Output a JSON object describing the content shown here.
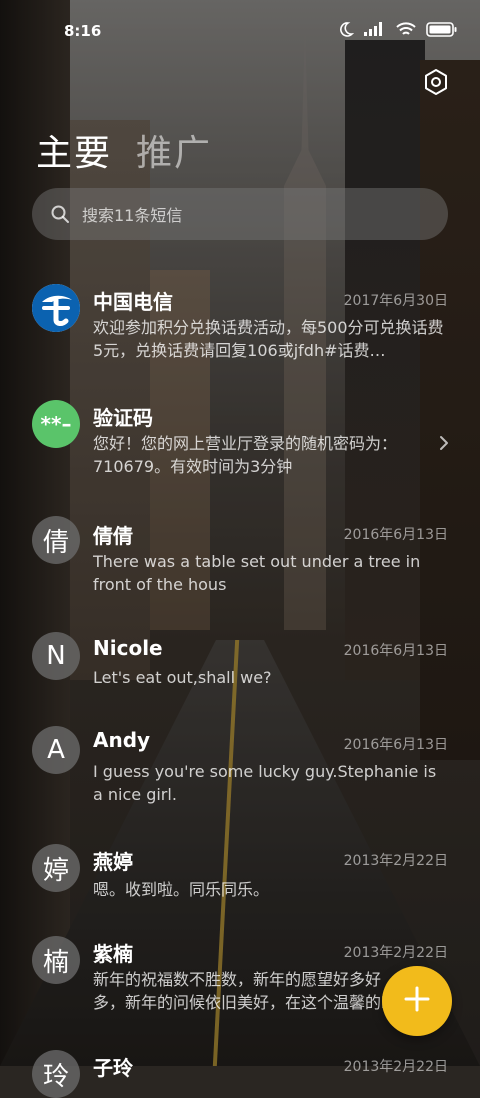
{
  "status_bar": {
    "time": "8:16"
  },
  "tabs": {
    "main": "主要",
    "promo": "推广"
  },
  "search": {
    "placeholder": "搜索11条短信"
  },
  "conversations": [
    {
      "name": "中国电信",
      "date": "2017年6月30日",
      "preview": "欢迎参加积分兑换话费活动，每500分可兑换话费5元，兑换话费请回复106或jfdh#话费…",
      "avatar": "telecom-logo"
    },
    {
      "name": "验证码",
      "date": "",
      "preview": "您好！您的网上营业厅登录的随机密码为：710679。有效时间为3分钟",
      "avatar": "**–"
    },
    {
      "name": "倩倩",
      "date": "2016年6月13日",
      "preview": "There was a table set out under a tree in front of the hous",
      "avatar": "倩"
    },
    {
      "name": "Nicole",
      "date": "2016年6月13日",
      "preview": "Let's eat out,shall we?",
      "avatar": "N"
    },
    {
      "name": "Andy",
      "date": "2016年6月13日",
      "preview": "I guess you're some lucky guy.Stephanie is a nice girl.",
      "avatar": "A"
    },
    {
      "name": "燕婷",
      "date": "2013年2月22日",
      "preview": "嗯。收到啦。同乐同乐。",
      "avatar": "婷"
    },
    {
      "name": "紫楠",
      "date": "2013年2月22日",
      "preview": "新年的祝福数不胜数，新年的愿望好多好多，新年的问候依旧美好，在这个温馨的时刻",
      "avatar": "楠"
    },
    {
      "name": "子玲",
      "date": "2013年2月22日",
      "preview": "",
      "avatar": "玲"
    }
  ],
  "colors": {
    "fab": "#f2bb1b",
    "verify_avatar": "#5ac46a",
    "telecom_blue": "#0b62b0"
  },
  "icons": [
    "moon-icon",
    "signal-icon",
    "wifi-icon",
    "battery-icon",
    "settings-icon",
    "search-icon",
    "chevron-right-icon",
    "plus-icon"
  ]
}
